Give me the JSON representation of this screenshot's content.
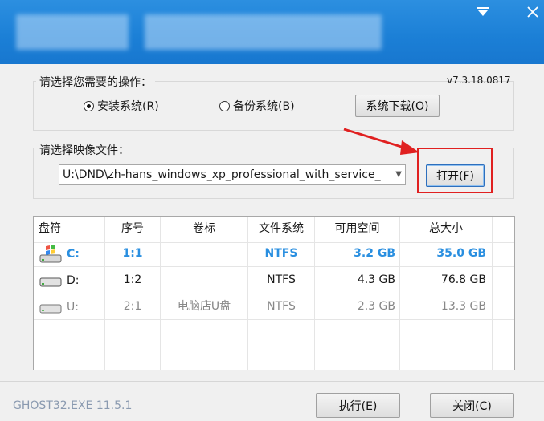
{
  "window": {
    "menu_icon": "chevron-down-icon",
    "close_icon": "close-icon",
    "accent": "#1b7fd6"
  },
  "operation": {
    "label": "请选择您需要的操作：",
    "version": "v7.3.18.0817",
    "install_label": "安装系统(R)",
    "install_selected": true,
    "backup_label": "备份系统(B)",
    "backup_selected": false,
    "download_label": "系统下载(O)"
  },
  "image": {
    "label": "请选择映像文件：",
    "path": "U:\\DND\\zh-hans_windows_xp_professional_with_service_",
    "open_label": "打开(F)",
    "highlight_color": "#e02020"
  },
  "table": {
    "columns": [
      "盘符",
      "序号",
      "卷标",
      "文件系统",
      "可用空间",
      "总大小"
    ],
    "rows": [
      {
        "drive": "C:",
        "index": "1:1",
        "label": "",
        "fs": "NTFS",
        "free": "3.2 GB",
        "total": "35.0 GB",
        "state": "selected",
        "icon": "windows-drive-icon"
      },
      {
        "drive": "D:",
        "index": "1:2",
        "label": "",
        "fs": "NTFS",
        "free": "4.3 GB",
        "total": "76.8 GB",
        "state": "normal",
        "icon": "hard-drive-icon"
      },
      {
        "drive": "U:",
        "index": "2:1",
        "label": "电脑店U盘",
        "fs": "NTFS",
        "free": "2.3 GB",
        "total": "13.3 GB",
        "state": "dim",
        "icon": "hard-drive-icon"
      }
    ]
  },
  "footer": {
    "status": "GHOST32.EXE 11.5.1",
    "execute_label": "执行(E)",
    "close_label": "关闭(C)"
  }
}
